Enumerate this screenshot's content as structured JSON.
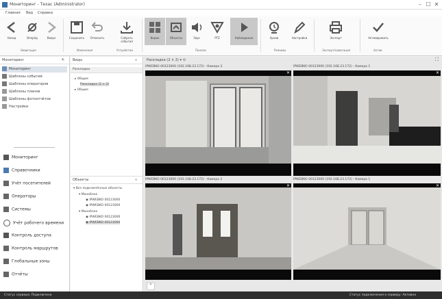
{
  "window": {
    "title": "Мониторинг - Техас (Administrator)",
    "min": "–",
    "max": "☐",
    "close": "✕"
  },
  "menu": [
    "Главная",
    "Вид",
    "Справка"
  ],
  "ribbon": {
    "buttons": [
      "Назад",
      "Вперёд",
      "Вверх",
      "Сохранить",
      "Отменить",
      "Собрать события",
      "Видео",
      "Объекты",
      "Звук",
      "PTZ",
      "Наблюдение",
      "Архив",
      "Настройки",
      "Экспорт",
      "Активировать"
    ],
    "groups": [
      "Навигация",
      "Изменения",
      "Устройства",
      "Панели",
      "Режимы",
      "Экспорт/навигация",
      "Актив"
    ]
  },
  "left_pane": {
    "header": "Мониторинг",
    "items": [
      "Мониторинг",
      "Шаблоны событий",
      "Шаблоны операторов",
      "Шаблоны планов",
      "Шаблоны фотоотчётов",
      "Настройки"
    ],
    "nav": [
      "Мониторинг",
      "Справочники",
      "Учёт посетителей",
      "Операторы",
      "Системы",
      "Учёт рабочего времени",
      "Контроль доступа",
      "Контроль маршрутов",
      "Глобальные зоны",
      "Отчёты"
    ]
  },
  "mid_pane": {
    "header_top": "Виды",
    "subheader": "Раскладки",
    "tree_top": [
      "Общие",
      "Раскладка (2 × 2)",
      "Общие"
    ],
    "header_bottom": "Объекты",
    "tree_bottom": [
      "Все подключённые объекты",
      "Моноблок",
      "IPWEBKO 00123000",
      "IPWEBKO 00123000",
      "Моноблок",
      "IPWEBKO 00123000",
      "IPWEBKO 00123000"
    ]
  },
  "cams": {
    "layout_label": "Раскладка (2 × 2)",
    "labels": [
      "IPWEBKO 00123000 (192.168.23.172) - Камера 3",
      "IPWEBKO 00123000 (192.168.23.172) - Камера 1",
      "IPWEBKO 00123000 (192.168.23.172) - Камера 2",
      "IPWEBKO 00123000 (192.168.23.172) - Камера 1"
    ]
  },
  "status": {
    "left": "Статус сервера: Подключено",
    "right": "Статус подключения к серверу: Активно"
  }
}
